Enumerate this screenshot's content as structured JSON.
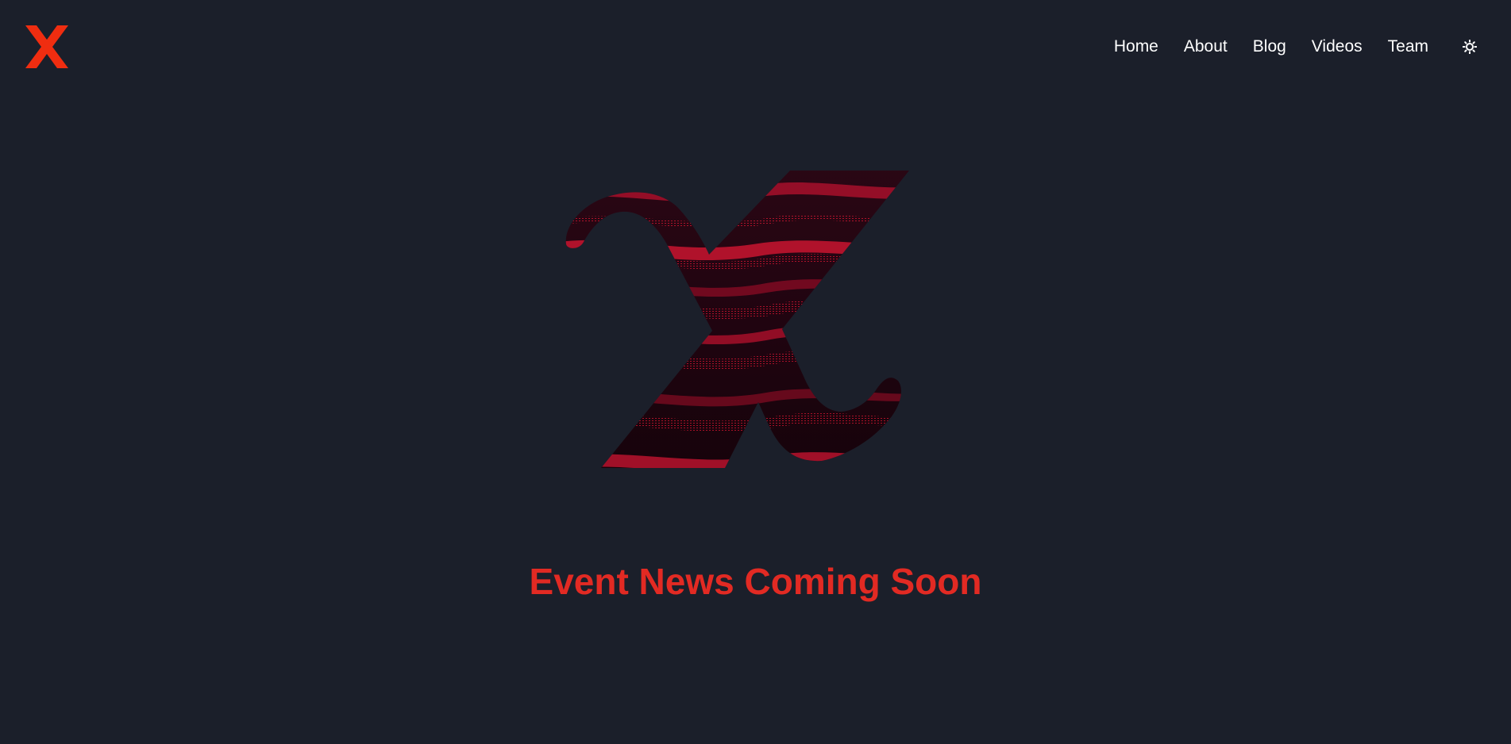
{
  "brand": {
    "logo_icon": "x-logo-icon",
    "accent_color": "#f02d10"
  },
  "nav": {
    "items": [
      {
        "label": "Home"
      },
      {
        "label": "About"
      },
      {
        "label": "Blog"
      },
      {
        "label": "Videos"
      },
      {
        "label": "Team"
      }
    ],
    "theme_toggle_icon": "sun-icon"
  },
  "hero": {
    "graphic_icon": "x-wave-graphic",
    "headline": "Event News Coming Soon",
    "headline_color": "#e22a23"
  },
  "colors": {
    "background": "#1b1f2a",
    "nav_text": "#ffffff"
  }
}
